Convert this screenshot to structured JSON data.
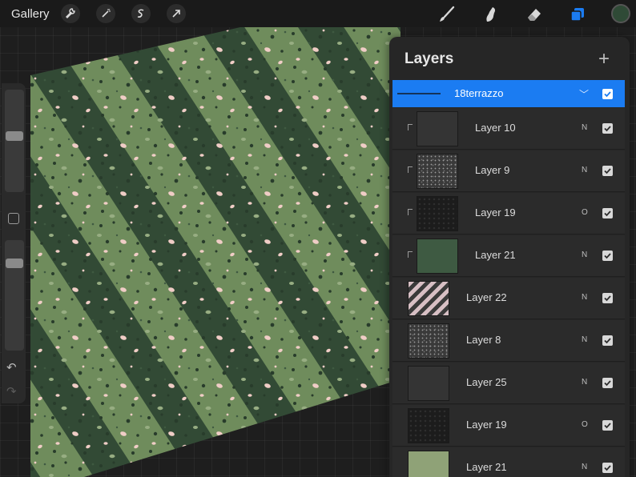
{
  "topbar": {
    "gallery_label": "Gallery",
    "left_tools": [
      "wrench-icon",
      "magic-wand-icon",
      "selection-icon",
      "transform-arrow-icon"
    ],
    "right_tools": [
      "brush-icon",
      "smudge-icon",
      "eraser-icon",
      "layers-icon"
    ],
    "active_color": "#2f4a36",
    "active_tool_color": "#1b7cf2"
  },
  "sidebar": {
    "brush_size_level": 0.55,
    "opacity_level": 0.82
  },
  "artwork": {
    "description": "terrazzo",
    "colors": {
      "light_stripe": "#6f8c5c",
      "dark_stripe": "#324a35",
      "speckle_pink": "#f0cdc6",
      "speckle_dark": "#283c2b"
    }
  },
  "layers": {
    "title": "Layers",
    "group": {
      "name": "18terrazzo",
      "visible": true
    },
    "items": [
      {
        "name": "Layer 10",
        "blend": "N",
        "visible": true,
        "clipped": true,
        "thumb": "dark"
      },
      {
        "name": "Layer 9",
        "blend": "N",
        "visible": true,
        "clipped": true,
        "thumb": "speckle"
      },
      {
        "name": "Layer 19",
        "blend": "O",
        "visible": true,
        "clipped": true,
        "thumb": "black"
      },
      {
        "name": "Layer 21",
        "blend": "N",
        "visible": true,
        "clipped": true,
        "thumb": "green"
      },
      {
        "name": "Layer 22",
        "blend": "N",
        "visible": true,
        "clipped": false,
        "thumb": "stripes"
      },
      {
        "name": "Layer 8",
        "blend": "N",
        "visible": true,
        "clipped": false,
        "thumb": "speckle"
      },
      {
        "name": "Layer 25",
        "blend": "N",
        "visible": true,
        "clipped": false,
        "thumb": "dark"
      },
      {
        "name": "Layer 19",
        "blend": "O",
        "visible": true,
        "clipped": false,
        "thumb": "black"
      },
      {
        "name": "Layer 21",
        "blend": "N",
        "visible": true,
        "clipped": false,
        "thumb": "lightgreen"
      }
    ]
  }
}
